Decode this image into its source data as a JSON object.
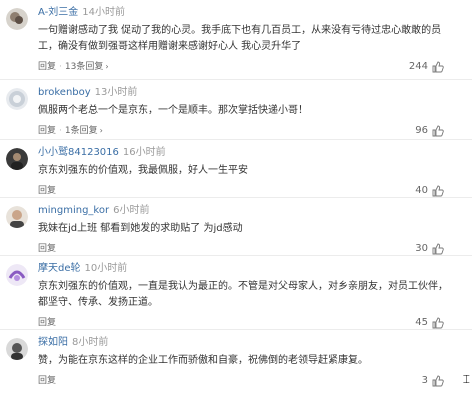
{
  "comments": [
    {
      "author": "A-刘三金",
      "time": "14小时前",
      "text": "一句赠谢感动了我 促动了我的心灵。我手底下也有几百员工，从来没有亏待过忠心敢敢的员工，确没有做到强哥这样用赠谢来感谢好心人 我心灵升华了",
      "reply": "回复",
      "replies": "13条回复",
      "likes": "244",
      "avatar_icon": "user-avatar-icon"
    },
    {
      "author": "brokenboy",
      "time": "13小时前",
      "text": "佩服两个老总一个是京东，一个是顺丰。那次掌括快递小哥！",
      "reply": "回复",
      "replies": "1条回复",
      "likes": "96",
      "avatar_icon": "user-avatar-icon"
    },
    {
      "author": "小小鹫84123016",
      "time": "16小时前",
      "text": "京东刘强东的价值观，我最佩服，好人一生平安",
      "reply": "回复",
      "replies": "",
      "likes": "40",
      "avatar_icon": "user-avatar-icon"
    },
    {
      "author": "mingming_kor",
      "time": "6小时前",
      "text": "我妹在jd上班 郁看到她发的求助贴了 为jd感动",
      "reply": "回复",
      "replies": "",
      "likes": "30",
      "avatar_icon": "user-avatar-icon"
    },
    {
      "author": "摩天de轮",
      "time": "10小时前",
      "text": "京东刘强东的价值观，一直是我认为最正的。不管是对父母家人，对乡亲朋友，对员工伙伴，都坚守、传承、发扬正道。",
      "reply": "回复",
      "replies": "",
      "likes": "45",
      "avatar_icon": "user-avatar-icon"
    },
    {
      "author": "探如阳",
      "time": "8小时前",
      "text": "赞，为能在京东这样的企业工作而骄傲和自豪，祝佛倒的老领导赶紧康复。",
      "reply": "回复",
      "replies": "",
      "likes": "3",
      "avatar_icon": "user-avatar-icon"
    }
  ],
  "colors": {
    "author": "#3a6ea5",
    "muted": "#999999",
    "text": "#333333"
  }
}
